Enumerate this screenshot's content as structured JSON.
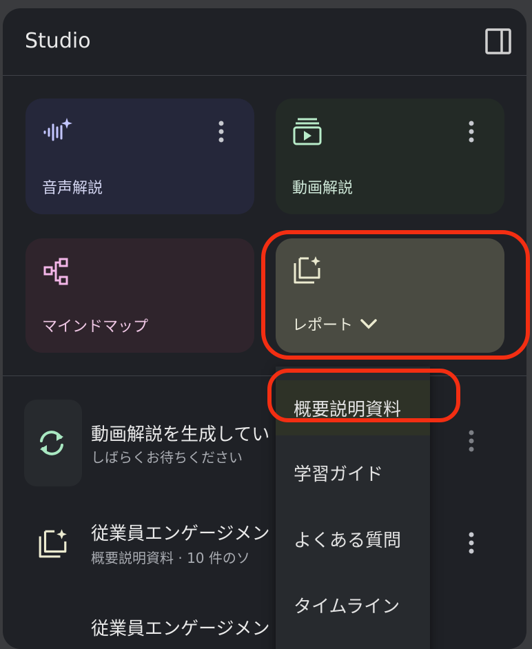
{
  "header": {
    "title": "Studio",
    "toggle_icon": "side-panel-icon"
  },
  "cards": {
    "audio": {
      "label": "音声解説",
      "icon": "audio-spark-icon",
      "color": "#c3c6ff"
    },
    "video": {
      "label": "動画解説",
      "icon": "video-slides-icon",
      "color": "#b8ecc9"
    },
    "mindmap": {
      "label": "マインドマップ",
      "icon": "mindmap-icon",
      "color": "#f3b6e8"
    },
    "report": {
      "label": "レポート",
      "icon": "report-spark-icon",
      "color": "#ecebd0"
    }
  },
  "items": [
    {
      "title": "動画解説を生成してい",
      "subtitle": "しばらくお待ちください",
      "icon": "sync-icon"
    },
    {
      "title": "従業員エンゲージメン",
      "subtitle": "概要説明資料 · 10 件のソ",
      "icon": "report-spark-icon"
    },
    {
      "title": "従業員エンゲージメン"
    }
  ],
  "menu": {
    "options": [
      "概要説明資料",
      "学習ガイド",
      "よくある質問",
      "タイムライン"
    ],
    "selected": "概要説明資料"
  },
  "annotation_color": "#f32e12"
}
